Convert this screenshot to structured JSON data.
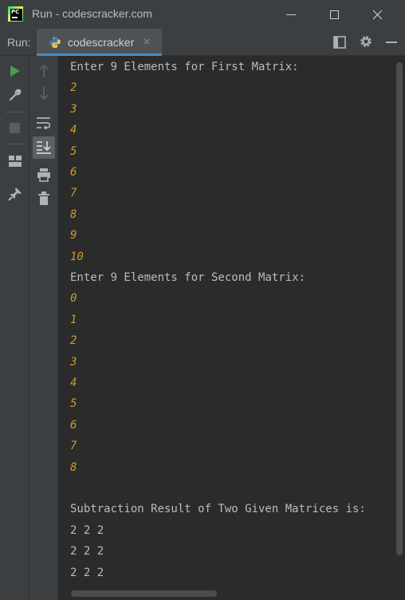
{
  "window": {
    "title": "Run - codescracker.com",
    "app_icon_text": "PC"
  },
  "run_toolbar": {
    "label": "Run:",
    "tab_label": "codescracker",
    "tab_close": "×"
  },
  "console": {
    "lines": [
      {
        "text": "Enter 9 Elements for First Matrix:",
        "kind": "prompt"
      },
      {
        "text": "2",
        "kind": "input"
      },
      {
        "text": "3",
        "kind": "input"
      },
      {
        "text": "4",
        "kind": "input"
      },
      {
        "text": "5",
        "kind": "input"
      },
      {
        "text": "6",
        "kind": "input"
      },
      {
        "text": "7",
        "kind": "input"
      },
      {
        "text": "8",
        "kind": "input"
      },
      {
        "text": "9",
        "kind": "input"
      },
      {
        "text": "10",
        "kind": "input"
      },
      {
        "text": "Enter 9 Elements for Second Matrix:",
        "kind": "prompt"
      },
      {
        "text": "0",
        "kind": "input"
      },
      {
        "text": "1",
        "kind": "input"
      },
      {
        "text": "2",
        "kind": "input"
      },
      {
        "text": "3",
        "kind": "input"
      },
      {
        "text": "4",
        "kind": "input"
      },
      {
        "text": "5",
        "kind": "input"
      },
      {
        "text": "6",
        "kind": "input"
      },
      {
        "text": "7",
        "kind": "input"
      },
      {
        "text": "8",
        "kind": "input"
      },
      {
        "text": "",
        "kind": "out"
      },
      {
        "text": "Subtraction Result of Two Given Matrices is:",
        "kind": "out"
      },
      {
        "text": "2 2 2",
        "kind": "out"
      },
      {
        "text": "2 2 2",
        "kind": "out"
      },
      {
        "text": "2 2 2",
        "kind": "out"
      }
    ]
  },
  "colors": {
    "input_text": "#cc9c2d",
    "output_text": "#bbbbbb",
    "run_green": "#499c54",
    "tab_underline": "#4a88c7"
  }
}
